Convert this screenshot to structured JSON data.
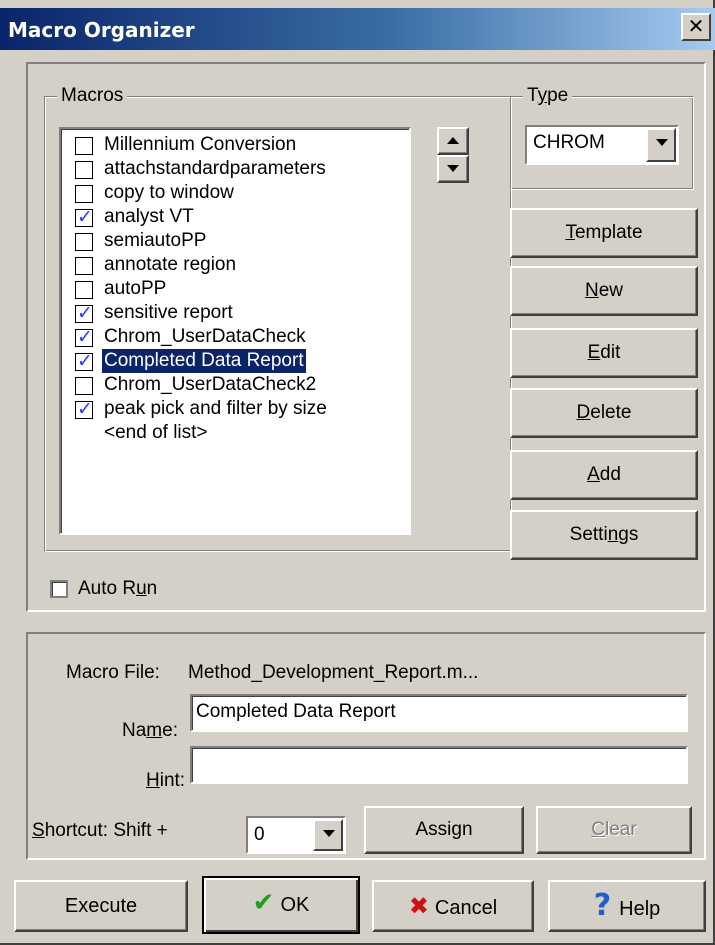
{
  "window": {
    "title": "Macro Organizer",
    "close_glyph": "✕"
  },
  "macros": {
    "group_label": "Macros",
    "items": [
      {
        "label": "Millennium Conversion",
        "checked": false
      },
      {
        "label": "attachstandardparameters",
        "checked": false
      },
      {
        "label": "copy to window",
        "checked": false
      },
      {
        "label": "analyst VT",
        "checked": true
      },
      {
        "label": "semiautoPP",
        "checked": false
      },
      {
        "label": "annotate region",
        "checked": false
      },
      {
        "label": "autoPP",
        "checked": false
      },
      {
        "label": "sensitive report",
        "checked": true
      },
      {
        "label": "Chrom_UserDataCheck",
        "checked": true
      },
      {
        "label": "Completed Data Report",
        "checked": true,
        "selected": true
      },
      {
        "label": "Chrom_UserDataCheck2",
        "checked": false
      },
      {
        "label": "peak pick and filter by size",
        "checked": true
      }
    ],
    "end_marker": "<end of list>",
    "check_glyph": "✓",
    "check_color": "#1e3cff",
    "selection_color": "#0a246a"
  },
  "type": {
    "group_pre": "T",
    "group_mn": "y",
    "group_post": "pe",
    "value": "CHROM"
  },
  "buttons": {
    "template": {
      "mn": "T",
      "rest": "emplate"
    },
    "new": {
      "mn": "N",
      "rest": "ew"
    },
    "edit": {
      "mn": "E",
      "rest": "dit"
    },
    "delete": {
      "mn": "D",
      "rest": "elete"
    },
    "add": {
      "mn": "A",
      "rest": "dd"
    },
    "settings": {
      "pre": "Setti",
      "mn": "n",
      "post": "gs"
    }
  },
  "auto_run": {
    "pre": "Auto R",
    "mn": "u",
    "post": "n",
    "checked": false
  },
  "details": {
    "macro_file_label": "Macro File:",
    "macro_file_value": "Method_Development_Report.m...",
    "name_pre": "Na",
    "name_mn": "m",
    "name_post": "e:",
    "name_value": "Completed Data Report",
    "hint_mn": "H",
    "hint_post": "int:",
    "hint_value": "",
    "shortcut_mn": "S",
    "shortcut_post": "hortcut: Shift +",
    "shortcut_value": "0",
    "assign_pre": "Assi",
    "assign_mn": "g",
    "assign_post": "n",
    "clear_mn": "C",
    "clear_post": "lear"
  },
  "footer": {
    "execute": "Execute",
    "ok": "OK",
    "ok_icon": "✔",
    "ok_color": "#1f9e1f",
    "cancel": "Cancel",
    "cancel_icon": "✖",
    "cancel_color": "#cc1111",
    "help": "Help",
    "help_icon": "?",
    "help_color": "#1f5fd0"
  }
}
